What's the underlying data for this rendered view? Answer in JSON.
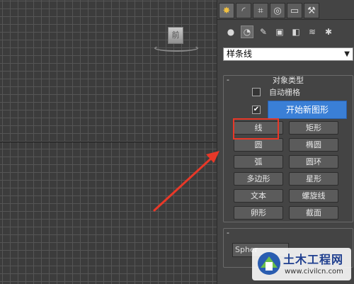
{
  "viewport": {
    "viewcube_label": "前"
  },
  "panel": {
    "tabs": [
      {
        "icon": "create-icon",
        "glyph": "✸",
        "active": true
      },
      {
        "icon": "modify-icon",
        "glyph": "◜"
      },
      {
        "icon": "hierarchy-icon",
        "glyph": "⌗"
      },
      {
        "icon": "motion-icon",
        "glyph": "◎"
      },
      {
        "icon": "display-icon",
        "glyph": "▭"
      },
      {
        "icon": "utilities-icon",
        "glyph": "⚒"
      }
    ],
    "subcategories": [
      {
        "icon": "geometry-icon",
        "glyph": "●"
      },
      {
        "icon": "shapes-icon",
        "glyph": "◔",
        "selected": true
      },
      {
        "icon": "lights-icon",
        "glyph": "✎"
      },
      {
        "icon": "cameras-icon",
        "glyph": "▣"
      },
      {
        "icon": "helpers-icon",
        "glyph": "◧"
      },
      {
        "icon": "space-warps-icon",
        "glyph": "≋"
      },
      {
        "icon": "systems-icon",
        "glyph": "✱"
      }
    ],
    "category_dropdown": "样条线",
    "object_type": {
      "title": "对象类型",
      "minus": "-",
      "autogrid_label": "自动栅格",
      "start_new_shape_checked": "✔",
      "start_new_shape_label": "开始新图形",
      "buttons": [
        "线",
        "矩形",
        "圆",
        "椭圆",
        "弧",
        "圆环",
        "多边形",
        "星形",
        "文本",
        "螺旋线",
        "卵形",
        "截面"
      ]
    },
    "name_color": {
      "minus": "-",
      "field_value": "Spher"
    }
  },
  "watermark": {
    "title": "土木工程网",
    "url": "www.civilcn.com"
  }
}
